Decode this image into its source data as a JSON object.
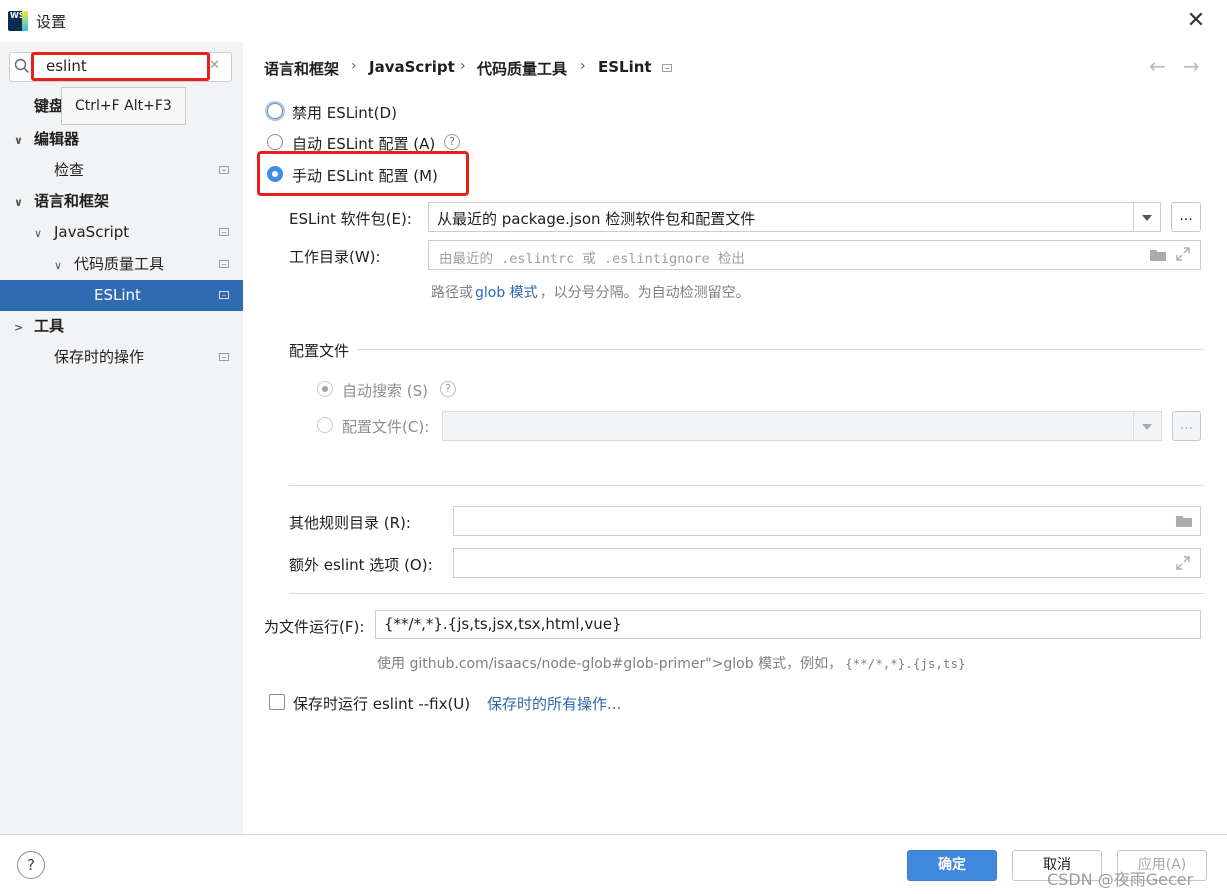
{
  "window": {
    "title": "设置"
  },
  "sidebar": {
    "search_value": "eslint",
    "shortcut_tooltip": "Ctrl+F Alt+F3",
    "items": [
      {
        "label": "键盘"
      },
      {
        "label": "编辑器"
      },
      {
        "label": "检查"
      },
      {
        "label": "语言和框架"
      },
      {
        "label": "JavaScript"
      },
      {
        "label": "代码质量工具"
      },
      {
        "label": "ESLint"
      },
      {
        "label": "工具"
      },
      {
        "label": "保存时的操作"
      }
    ]
  },
  "breadcrumb": [
    "语言和框架",
    "JavaScript",
    "代码质量工具",
    "ESLint"
  ],
  "options": {
    "disable": "禁用 ESLint(D)",
    "auto": "自动 ESLint 配置 (A)",
    "manual": "手动 ESLint 配置 (M)"
  },
  "package": {
    "label": "ESLint 软件包(E):",
    "value": "从最近的 package.json 检测软件包和配置文件",
    "browse": "..."
  },
  "workdir": {
    "label": "工作目录(W):",
    "placeholder": "由最近的 .eslintrc 或 .eslintignore 检出"
  },
  "workdir_hint": {
    "prefix": "路径或",
    "link": "glob 模式",
    "suffix": "，以分号分隔。为自动检测留空。"
  },
  "config": {
    "section": "配置文件",
    "auto_search": "自动搜索 (S)",
    "config_file": "配置文件(C):",
    "browse": "..."
  },
  "rules_dir": {
    "label": "其他规则目录 (R):"
  },
  "extra_options": {
    "label": "额外 eslint 选项 (O):"
  },
  "run_for": {
    "label": "为文件运行(F):",
    "value": "{**/*,*}.{js,ts,jsx,tsx,html,vue}"
  },
  "run_hint": {
    "text": "使用 github.com/isaacs/node-glob#glob-primer\">glob 模式，例如，",
    "example": "{**/*,*}.{js,ts}"
  },
  "fix_on_save": {
    "label": "保存时运行 eslint --fix(U)",
    "link": "保存时的所有操作..."
  },
  "footer": {
    "ok": "确定",
    "cancel": "取消",
    "apply": "应用(A)",
    "help": "?",
    "watermark": "CSDN @夜雨Gecer"
  },
  "colors": {
    "accent": "#3f88de",
    "selection": "#2f6ab3",
    "highlight_red": "#e8201a"
  }
}
